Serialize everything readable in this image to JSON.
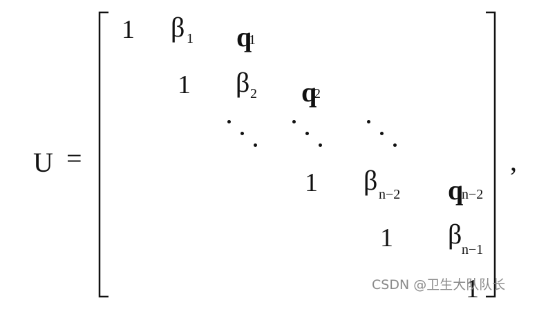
{
  "equation": {
    "lhs": "U",
    "equals": "=",
    "trailing_comma": ",",
    "row1": {
      "one": "1",
      "beta": "β",
      "beta_sub": "1",
      "q": "q",
      "q_sub": "1"
    },
    "row2": {
      "one": "1",
      "beta": "β",
      "beta_sub": "2",
      "q": "q",
      "q_sub": "2"
    },
    "row4": {
      "one": "1",
      "beta": "β",
      "beta_sub": "n−2",
      "q": "q",
      "q_sub": "n−2"
    },
    "row5": {
      "one": "1",
      "beta": "β",
      "beta_sub": "n−1"
    },
    "row6": {
      "one": "1"
    }
  },
  "watermark": "CSDN @卫生大队队长",
  "colors": {
    "ink": "#111111",
    "watermark": "#8a8a8a",
    "background": "#ffffff"
  }
}
